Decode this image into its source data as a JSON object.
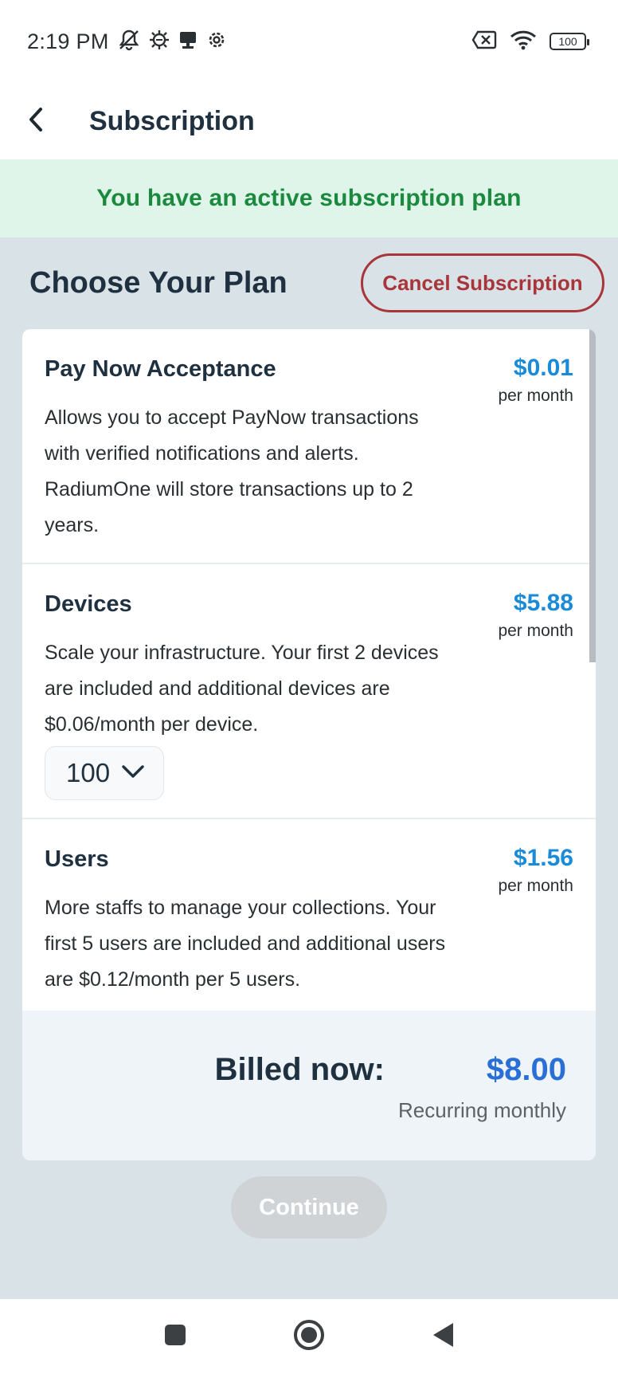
{
  "status_bar": {
    "time": "2:19 PM",
    "battery": "100",
    "left_icons": [
      "mute-bell-icon",
      "gear-bug-icon",
      "cast-icon",
      "settings-icon"
    ],
    "right_icons": [
      "sim-off-icon",
      "wifi-icon",
      "battery-icon"
    ]
  },
  "app_bar": {
    "title": "Subscription",
    "back_icon": "chevron-left-icon"
  },
  "banner": {
    "text": "You have an active subscription plan"
  },
  "header": {
    "title": "Choose Your Plan",
    "cancel_label": "Cancel Subscription"
  },
  "plans": [
    {
      "name": "Pay Now Acceptance",
      "price": "$0.01",
      "period": "per month",
      "description": "Allows you to accept PayNow transactions with verified notifications and alerts. RadiumOne will store transactions up to 2 years."
    },
    {
      "name": "Devices",
      "price": "$5.88",
      "period": "per month",
      "description": "Scale your infrastructure. Your first 2 devices are included and additional devices are $0.06/month per device.",
      "selected_quantity": "100"
    },
    {
      "name": "Users",
      "price": "$1.56",
      "period": "per month",
      "description": "More staffs to manage your collections. Your first 5 users are included and additional users are $0.12/month per 5 users."
    }
  ],
  "billing": {
    "label": "Billed now:",
    "amount": "$8.00",
    "note": "Recurring monthly"
  },
  "continue_label": "Continue",
  "colors": {
    "accent_price": "#1a8bd6",
    "billed_amount": "#2a6fd6",
    "cancel": "#a8353a",
    "banner_text": "#1b8a3f",
    "banner_bg": "#dff5ea",
    "page_bg": "#d9e2e7"
  }
}
